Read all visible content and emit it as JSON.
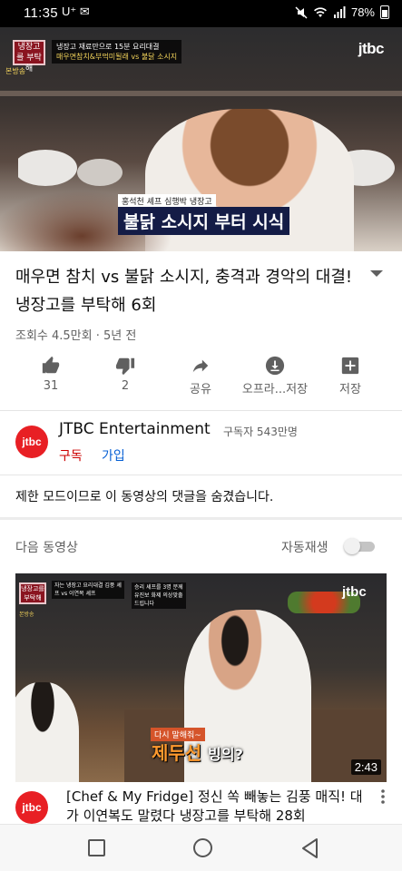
{
  "status_bar": {
    "time": "11:35",
    "carrier": "U⁺",
    "notif": "✉",
    "battery": "78%"
  },
  "player": {
    "badge": "냉장고를 부탁해",
    "caption_main": "냉장고 재료만으로 15분 요리대결",
    "caption_sub": "매우면참치&부먹미될래 vs 불닭 소시지",
    "bonbang": "본방송",
    "channel_logo": "jtbc",
    "subtitle_tag": "홍석천 셰프 심행박 냉장고",
    "subtitle_main": "불닭 소시지",
    "subtitle_accent": "부터 시식",
    "progress": 0.02
  },
  "video": {
    "title": "매우면 참치 vs 불닭 소시지, 충격과 경악의 대결! 냉장고를 부탁해 6회",
    "meta": "조회수 4.5만회 · 5년 전",
    "expand_icon": "chevron-down-icon"
  },
  "actions": [
    {
      "icon": "thumb-up-icon",
      "glyph": "👍",
      "label": "31"
    },
    {
      "icon": "thumb-down-icon",
      "glyph": "👎",
      "label": "2"
    },
    {
      "icon": "share-icon",
      "glyph": "➦",
      "label": "공유"
    },
    {
      "icon": "download-icon",
      "glyph": "⬇",
      "label": "오프라...저장"
    },
    {
      "icon": "add-to-playlist-icon",
      "glyph": "✚",
      "label": "저장"
    }
  ],
  "channel": {
    "avatar_text": "jtbc",
    "name": "JTBC Entertainment",
    "subscribers": "구독자 543만명",
    "subscribe_label": "구독",
    "join_label": "가입"
  },
  "comments": {
    "notice": "제한 모드이므로 이 동영상의 댓글을 숨겼습니다."
  },
  "up_next": {
    "label": "다음 동영상",
    "autoplay_label": "자동재생",
    "autoplay_on": false,
    "thumb": {
      "badge": "냉장고를 부탁해",
      "caption_a": "자는 냉장고 요리대결 김풍 셰프 vs 이연복 셰프",
      "caption_b": "승리 셰프를 3명 분께 유진보 화제 의상맞출 드립니다",
      "bonbang": "본방송",
      "channel_logo": "jtbc",
      "dasi": "다시 말해줘~",
      "subtitle": "제두선",
      "subtitle_tail": "빙의?",
      "duration": "2:43"
    },
    "avatar_text": "jtbc",
    "title": "[Chef & My Fridge] 정신 쏙 빼놓는 김풍 매직! 대가 이연복도 말렸다 냉장고를 부탁해 28회",
    "more_icon": "more-vert-icon"
  },
  "colors": {
    "accent_red": "#cc0000",
    "link_blue": "#065fd4",
    "jtbc_red": "#e81f24"
  }
}
